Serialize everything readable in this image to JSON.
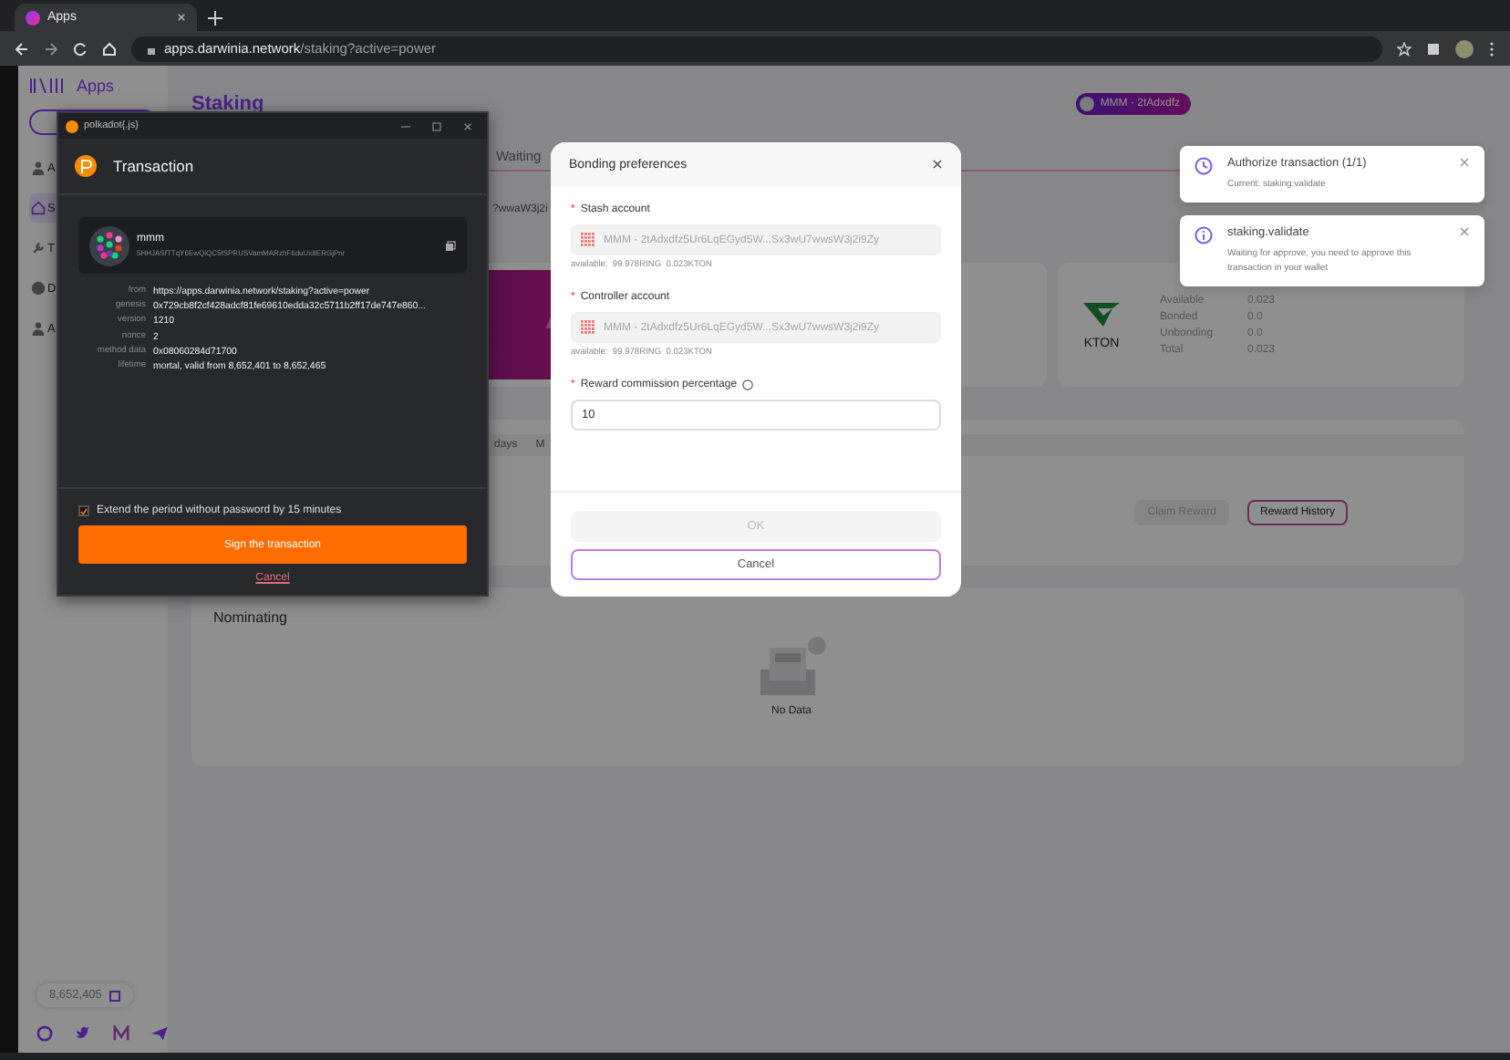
{
  "browser": {
    "tab_title": "Apps",
    "url_host": "apps.darwinia.network",
    "url_path": "/staking?active=power"
  },
  "sidebar": {
    "app_name": "Apps",
    "nav_items": [
      {
        "label": "A",
        "selected": false
      },
      {
        "label": "S",
        "selected": true
      },
      {
        "label": "T",
        "selected": false
      },
      {
        "label": "D",
        "selected": false
      },
      {
        "label": "A",
        "selected": false
      }
    ],
    "block_number": "8,652,405"
  },
  "main": {
    "title": "Staking",
    "account_chip": "MMM · 2tAdxdfz",
    "tabs": [
      {
        "label": "Waiting",
        "selected": false
      }
    ],
    "address_fragment": "?wwaW3j2i",
    "kton": {
      "name": "KTON",
      "stats": [
        {
          "label": "Available",
          "value": "0.023"
        },
        {
          "label": "Bonded",
          "value": "0.0"
        },
        {
          "label": "Unbonding",
          "value": "0.0"
        },
        {
          "label": "Total",
          "value": "0.023"
        }
      ]
    },
    "period_tabs": [
      "days",
      "M"
    ],
    "reward_buttons": [
      {
        "label": "Claim Reward",
        "disabled": true
      },
      {
        "label": "Reward History",
        "disabled": false
      }
    ],
    "nominating": {
      "title": "Nominating",
      "empty_text": "No Data"
    }
  },
  "modal": {
    "title": "Bonding preferences",
    "fields": [
      {
        "kind": "account",
        "required_mark": "*",
        "label": "Stash account",
        "value": "MMM - 2tAdxdfz5Ur6LqEGyd5W...Sx3wU7wwsW3j2i9Zy",
        "available": "available:  99.978RING  0.023KTON",
        "disabled": true
      },
      {
        "kind": "account",
        "required_mark": "*",
        "label": "Controller account",
        "value": "MMM - 2tAdxdfz5Ur6LqEGyd5W...Sx3wU7wwsW3j2i9Zy",
        "available": "available:  99.978RING  0.023KTON",
        "disabled": true
      },
      {
        "kind": "number",
        "required_mark": "*",
        "label": "Reward commission percentage",
        "value": "10"
      }
    ],
    "ok": {
      "label": "OK",
      "disabled": true
    },
    "cancel": "Cancel"
  },
  "extension": {
    "window_title": "polkadot{.js}",
    "heading": "Transaction",
    "account_name": "mmm",
    "account_address": "5HHJASfTTqY6EwQiQC5tSPRUSVamMARzhF6duUx8ERGjPnr",
    "details": [
      {
        "label": "from",
        "value": "https://apps.darwinia.network/staking?active=power"
      },
      {
        "label": "genesis",
        "value": "0x729cb8f2cf428adcf81fe69610edda32c5711b2ff17de747e860..."
      },
      {
        "label": "version",
        "value": "1210"
      },
      {
        "label": "nonce",
        "value": "2"
      },
      {
        "label": "method data",
        "value": "0x08060284d71700"
      },
      {
        "label": "lifetime",
        "value": "mortal, valid from 8,652,401 to 8,652,465"
      }
    ],
    "extend": {
      "label": "Extend the period without password by 15 minutes",
      "checked": true
    },
    "sign_label": "Sign the transaction",
    "cancel_label": "Cancel"
  },
  "notifications": [
    {
      "kind": "pending",
      "title": "Authorize transaction (1/1)",
      "text": "Current: staking.validate"
    },
    {
      "kind": "info",
      "title": "staking.validate",
      "text": "Waiting for approve, you need to approve this transaction in your wallet"
    }
  ]
}
